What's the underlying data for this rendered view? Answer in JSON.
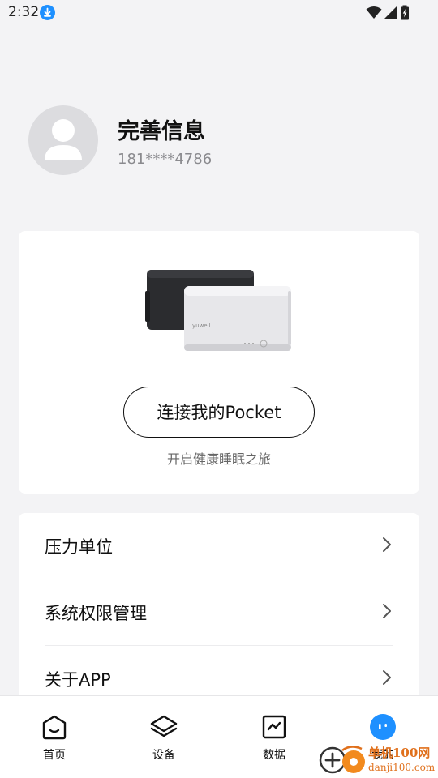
{
  "status_bar": {
    "time": "2:32",
    "icons": [
      "download-icon",
      "wifi-icon",
      "signal-icon",
      "battery-icon"
    ]
  },
  "profile": {
    "name": "完善信息",
    "phone": "181****4786"
  },
  "device_card": {
    "connect_label": "连接我的Pocket",
    "subtitle": "开启健康睡眠之旅"
  },
  "settings": {
    "items": [
      {
        "label": "压力单位"
      },
      {
        "label": "系统权限管理"
      },
      {
        "label": "关于APP"
      }
    ]
  },
  "bottom_nav": {
    "items": [
      {
        "label": "首页",
        "icon": "home-icon"
      },
      {
        "label": "设备",
        "icon": "layers-icon"
      },
      {
        "label": "数据",
        "icon": "chart-icon"
      },
      {
        "label": "我的",
        "icon": "face-icon",
        "active": true
      }
    ]
  },
  "watermark": {
    "line1": "单机100网",
    "line2": "danji100.com"
  },
  "colors": {
    "background": "#f3f3f5",
    "accent": "#1e90ff",
    "card": "#ffffff"
  }
}
